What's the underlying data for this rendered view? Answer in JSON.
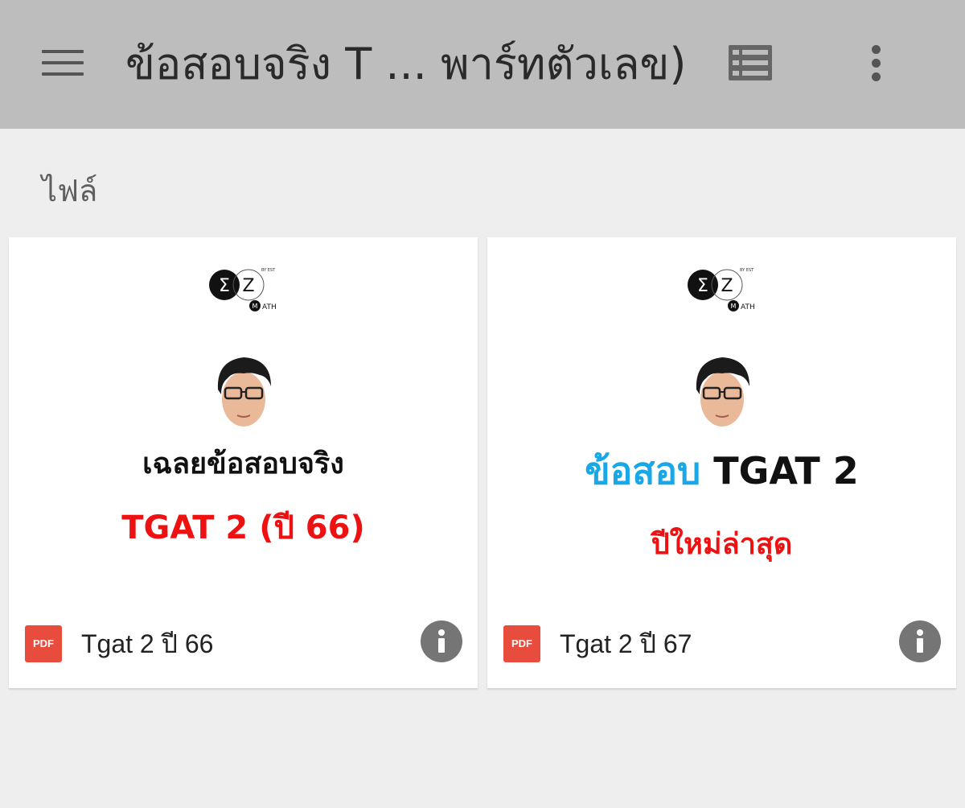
{
  "header": {
    "title": "ข้อสอบจริง T ... พาร์ทตัวเลข)",
    "menu_icon": "hamburger-menu-icon",
    "list_view_icon": "list-view-icon",
    "more_icon": "more-vert-icon",
    "background": "#bdbdbd"
  },
  "section": {
    "label": "ไฟล์"
  },
  "files": [
    {
      "name": "Tgat 2 ปี 66",
      "type_badge": "PDF",
      "thumbnail": {
        "logo_left": "Σ",
        "logo_right": "Z",
        "logo_sub": "ATH",
        "logo_small": "BY EST",
        "headline_1": "เฉลยข้อสอบจริง",
        "headline_2": "TGAT 2 (ปี 66)"
      }
    },
    {
      "name": "Tgat 2 ปี 67",
      "type_badge": "PDF",
      "thumbnail": {
        "logo_left": "Σ",
        "logo_right": "Z",
        "logo_sub": "ATH",
        "logo_small": "BY EST",
        "headline_1_blue": "ข้อสอบ",
        "headline_1_black": "TGAT 2",
        "headline_2": "ปีใหม่ล่าสุด"
      }
    }
  ],
  "colors": {
    "pdf_red": "#e84c3d",
    "headline_red": "#ee1111",
    "headline_blue": "#1aa7e6",
    "info_grey": "#757575"
  }
}
